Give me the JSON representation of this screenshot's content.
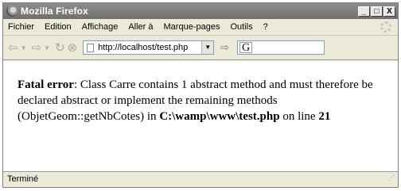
{
  "window": {
    "title": "Mozilla Firefox",
    "buttons": {
      "minimize": "_",
      "maximize": "□",
      "close": "X"
    }
  },
  "menu": {
    "items": [
      {
        "label": "Fichier"
      },
      {
        "label": "Edition"
      },
      {
        "label": "Affichage"
      },
      {
        "label": "Aller à"
      },
      {
        "label": "Marque-pages"
      },
      {
        "label": "Outils"
      },
      {
        "label": "?"
      }
    ]
  },
  "navbar": {
    "url": "http://localhost/test.php",
    "search_engine_glyph": "G"
  },
  "content": {
    "error_label": "Fatal error",
    "message_1": ": Class Carre contains 1 abstract method and must therefore be declared abstract or implement the remaining methods (ObjetGeom::getNbCotes) in ",
    "file_path": "C:\\wamp\\www\\test.php",
    "message_2": " on line ",
    "line_number": "21"
  },
  "status": {
    "text": "Terminé"
  },
  "icons": [
    "firefox-logo-icon",
    "back-icon",
    "forward-icon",
    "reload-icon",
    "stop-icon",
    "page-icon",
    "go-icon",
    "throbber-icon",
    "resize-grip-icon"
  ]
}
